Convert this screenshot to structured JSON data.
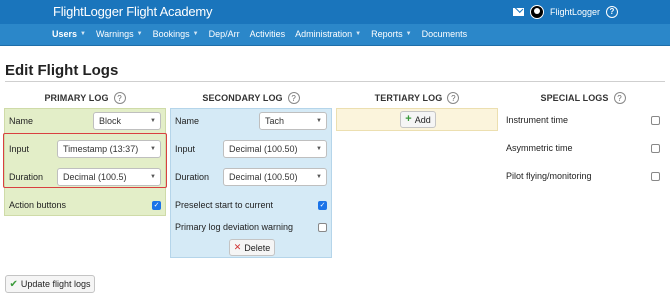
{
  "app": {
    "title": "FlightLogger Flight Academy",
    "user": "FlightLogger"
  },
  "topbar": {
    "mail_icon": "mail-icon",
    "help_glyph": "?"
  },
  "nav": {
    "items": [
      {
        "label": "Users",
        "caret": true
      },
      {
        "label": "Warnings",
        "caret": true
      },
      {
        "label": "Bookings",
        "caret": true
      },
      {
        "label": "Dep/Arr",
        "caret": false
      },
      {
        "label": "Activities",
        "caret": false
      },
      {
        "label": "Administration",
        "caret": true
      },
      {
        "label": "Reports",
        "caret": true
      },
      {
        "label": "Documents",
        "caret": false
      }
    ],
    "caret_glyph": "▼"
  },
  "page": {
    "title": "Edit Flight Logs"
  },
  "help_glyph": "?",
  "primary": {
    "heading": "PRIMARY LOG",
    "name_label": "Name",
    "name_value": "Block",
    "input_label": "Input",
    "input_value": "Timestamp (13:37)",
    "duration_label": "Duration",
    "duration_value": "Decimal (100.5)",
    "action_buttons_label": "Action buttons",
    "action_buttons_checked": true
  },
  "secondary": {
    "heading": "SECONDARY LOG",
    "name_label": "Name",
    "name_value": "Tach",
    "input_label": "Input",
    "input_value": "Decimal (100.50)",
    "duration_label": "Duration",
    "duration_value": "Decimal (100.50)",
    "preselect_label": "Preselect start to current",
    "preselect_checked": true,
    "deviation_label": "Primary log deviation warning",
    "deviation_checked": false,
    "delete_label": "Delete"
  },
  "tertiary": {
    "heading": "TERTIARY LOG",
    "add_label": "Add"
  },
  "special": {
    "heading": "SPECIAL LOGS",
    "items": [
      {
        "label": "Instrument time",
        "checked": false
      },
      {
        "label": "Asymmetric time",
        "checked": false
      },
      {
        "label": "Pilot flying/monitoring",
        "checked": false
      }
    ]
  },
  "footer": {
    "update_label": "Update flight logs"
  },
  "colors": {
    "topbar": "#1a75bc",
    "navbar": "#2b87c9",
    "primary_bg": "#e3eec8",
    "secondary_bg": "#d5eaf6",
    "tertiary_bg": "#fbf4dc",
    "highlight": "#d94040"
  }
}
